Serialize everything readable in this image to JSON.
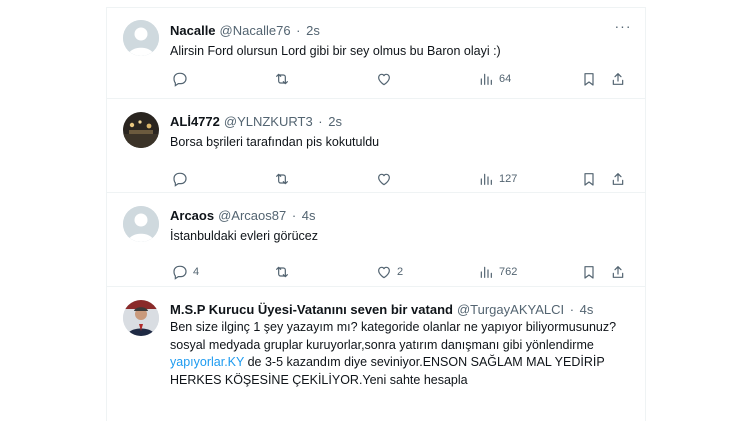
{
  "tweets": [
    {
      "name": "Nacalle",
      "handle": "@Nacalle76",
      "time": "2s",
      "text": "Alirsin Ford olursun Lord gibi bir sey olmus bu Baron olayi :)",
      "avatar": "default-avatar",
      "replies": "",
      "retweets": "",
      "likes": "",
      "views": "64"
    },
    {
      "name": "ALİ4772",
      "handle": "@YLNZKURT3",
      "time": "2s",
      "text": "Borsa bşrileri tarafından pis kokutuldu",
      "avatar": "photo-avatar",
      "replies": "",
      "retweets": "",
      "likes": "",
      "views": "127"
    },
    {
      "name": "Arcaos",
      "handle": "@Arcaos87",
      "time": "4s",
      "text": "İstanbuldaki evleri görücez",
      "avatar": "default-avatar",
      "replies": "4",
      "retweets": "",
      "likes": "2",
      "views": "762"
    },
    {
      "name": "M.S.P Kurucu Üyesi-Vatanını seven bir vatand",
      "handle": "@TurgayAKYALCI",
      "time": "4s",
      "text_part1": "Ben size ilginç 1 şey yazayım mı? kategoride olanlar ne yapıyor biliyormusunuz? sosyal medyada gruplar kuruyorlar,sonra yatırım danışmanı gibi yönlendirme ",
      "text_link": "yapıyorlar.KY",
      "text_part2": " de 3-5 kazandım diye seviniyor.ENSON SAĞLAM MAL YEDİRİP HERKES KÖŞESİNE ÇEKİLİYOR.Yeni sahte hesapla",
      "avatar": "photo-avatar-suit"
    }
  ],
  "more_glyph": "···",
  "colors": {
    "text": "#0f1419",
    "muted": "#536471",
    "link": "#1d9bf0",
    "border": "#eff3f4"
  }
}
